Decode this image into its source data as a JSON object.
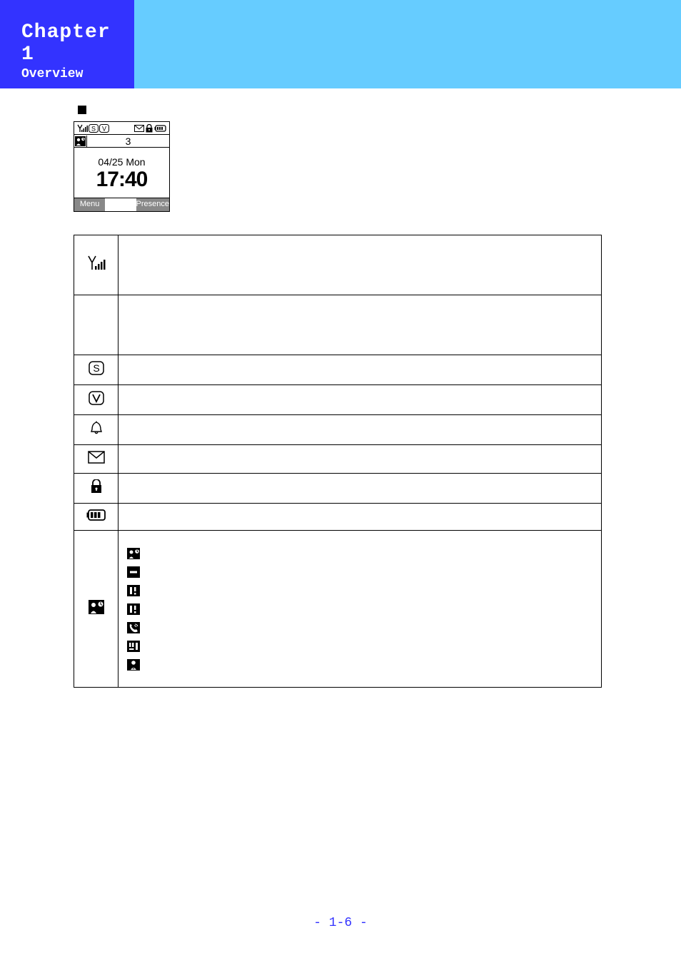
{
  "header": {
    "title": "Chapter 1",
    "subtitle": "Overview"
  },
  "phone": {
    "presence_count": "3",
    "date": "04/25 Mon",
    "time": "17:40",
    "softkey_left": "Menu",
    "softkey_right": "Presence"
  },
  "footer": {
    "page": "- 1-6 -"
  }
}
